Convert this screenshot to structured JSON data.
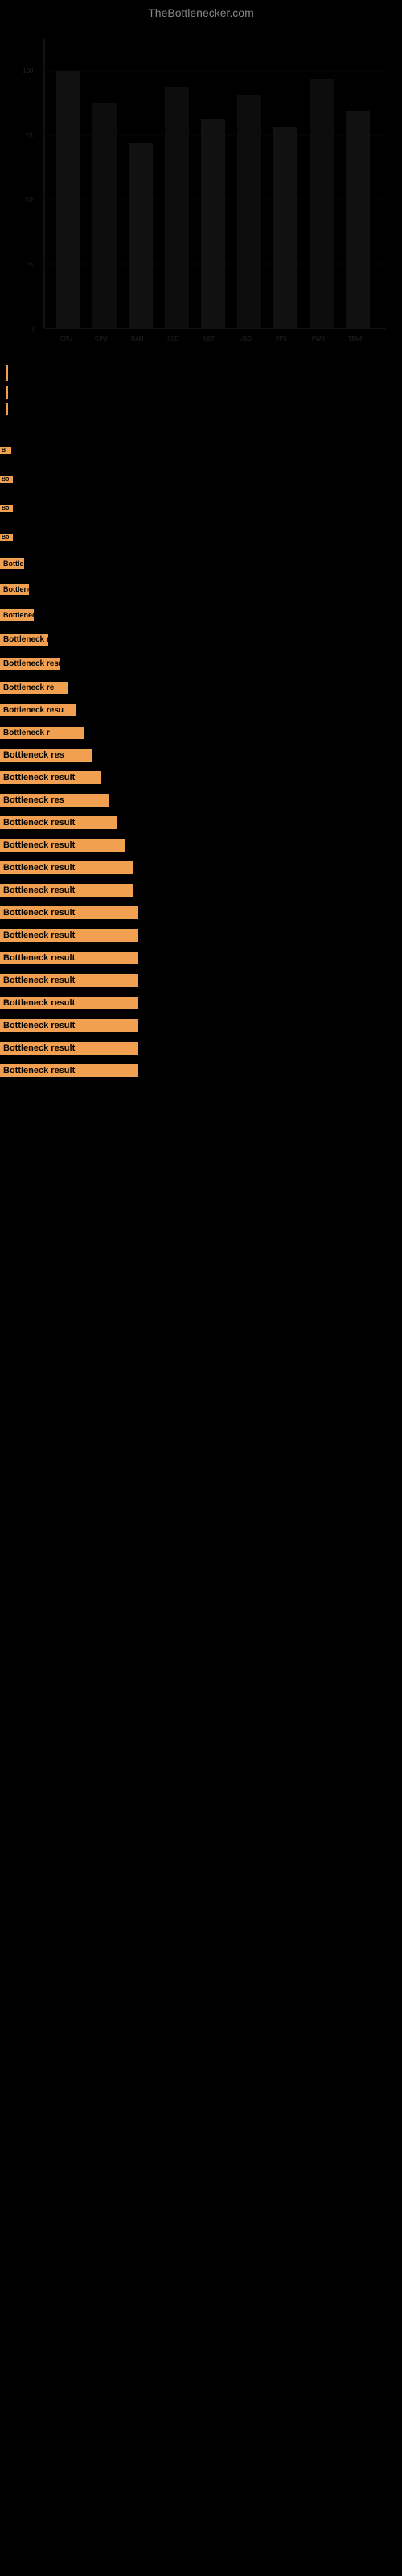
{
  "site": {
    "title": "TheBottlenecker.com"
  },
  "chart": {
    "has_content": true
  },
  "results": [
    {
      "id": 1,
      "label": "B",
      "size_class": "w-tiny1",
      "margin_top": 800
    },
    {
      "id": 2,
      "label": "Bo",
      "size_class": "w-tiny2",
      "margin_top": 20
    },
    {
      "id": 3,
      "label": "Bo",
      "size_class": "w-tiny2",
      "margin_top": 20
    },
    {
      "id": 4,
      "label": "Bo",
      "size_class": "w-tiny2",
      "margin_top": 20
    },
    {
      "id": 5,
      "label": "Bottlene",
      "size_class": "w-small1",
      "margin_top": 18
    },
    {
      "id": 6,
      "label": "Bottleneck r",
      "size_class": "w-small2",
      "margin_top": 16
    },
    {
      "id": 7,
      "label": "Bottleneck",
      "size_class": "w-small3",
      "margin_top": 16
    },
    {
      "id": 8,
      "label": "Bottleneck res",
      "size_class": "w-med1",
      "margin_top": 14
    },
    {
      "id": 9,
      "label": "Bottleneck result",
      "size_class": "w-med2",
      "margin_top": 14
    },
    {
      "id": 10,
      "label": "Bottleneck re",
      "size_class": "w-med3",
      "margin_top": 14
    },
    {
      "id": 11,
      "label": "Bottleneck resu",
      "size_class": "w-med4",
      "margin_top": 12
    },
    {
      "id": 12,
      "label": "Bottleneck r",
      "size_class": "w-med5",
      "margin_top": 12
    },
    {
      "id": 13,
      "label": "Bottleneck res",
      "size_class": "w-med6",
      "margin_top": 12
    },
    {
      "id": 14,
      "label": "Bottleneck result",
      "size_class": "w-large1",
      "margin_top": 10
    },
    {
      "id": 15,
      "label": "Bottleneck res",
      "size_class": "w-large2",
      "margin_top": 10
    },
    {
      "id": 16,
      "label": "Bottleneck result",
      "size_class": "w-large3",
      "margin_top": 10
    },
    {
      "id": 17,
      "label": "Bottleneck result",
      "size_class": "w-large4",
      "margin_top": 10
    },
    {
      "id": 18,
      "label": "Bottleneck result",
      "size_class": "w-large5",
      "margin_top": 10
    },
    {
      "id": 19,
      "label": "Bottleneck result",
      "size_class": "w-large5",
      "margin_top": 10
    },
    {
      "id": 20,
      "label": "Bottleneck result",
      "size_class": "w-large6",
      "margin_top": 10
    },
    {
      "id": 21,
      "label": "Bottleneck result",
      "size_class": "w-full1",
      "margin_top": 10
    },
    {
      "id": 22,
      "label": "Bottleneck result",
      "size_class": "w-full1",
      "margin_top": 10
    },
    {
      "id": 23,
      "label": "Bottleneck result",
      "size_class": "w-full1",
      "margin_top": 10
    },
    {
      "id": 24,
      "label": "Bottleneck result",
      "size_class": "w-full1",
      "margin_top": 10
    },
    {
      "id": 25,
      "label": "Bottleneck result",
      "size_class": "w-full1",
      "margin_top": 10
    },
    {
      "id": 26,
      "label": "Bottleneck result",
      "size_class": "w-full1",
      "margin_top": 10
    },
    {
      "id": 27,
      "label": "Bottleneck result",
      "size_class": "w-full1",
      "margin_top": 10
    }
  ]
}
